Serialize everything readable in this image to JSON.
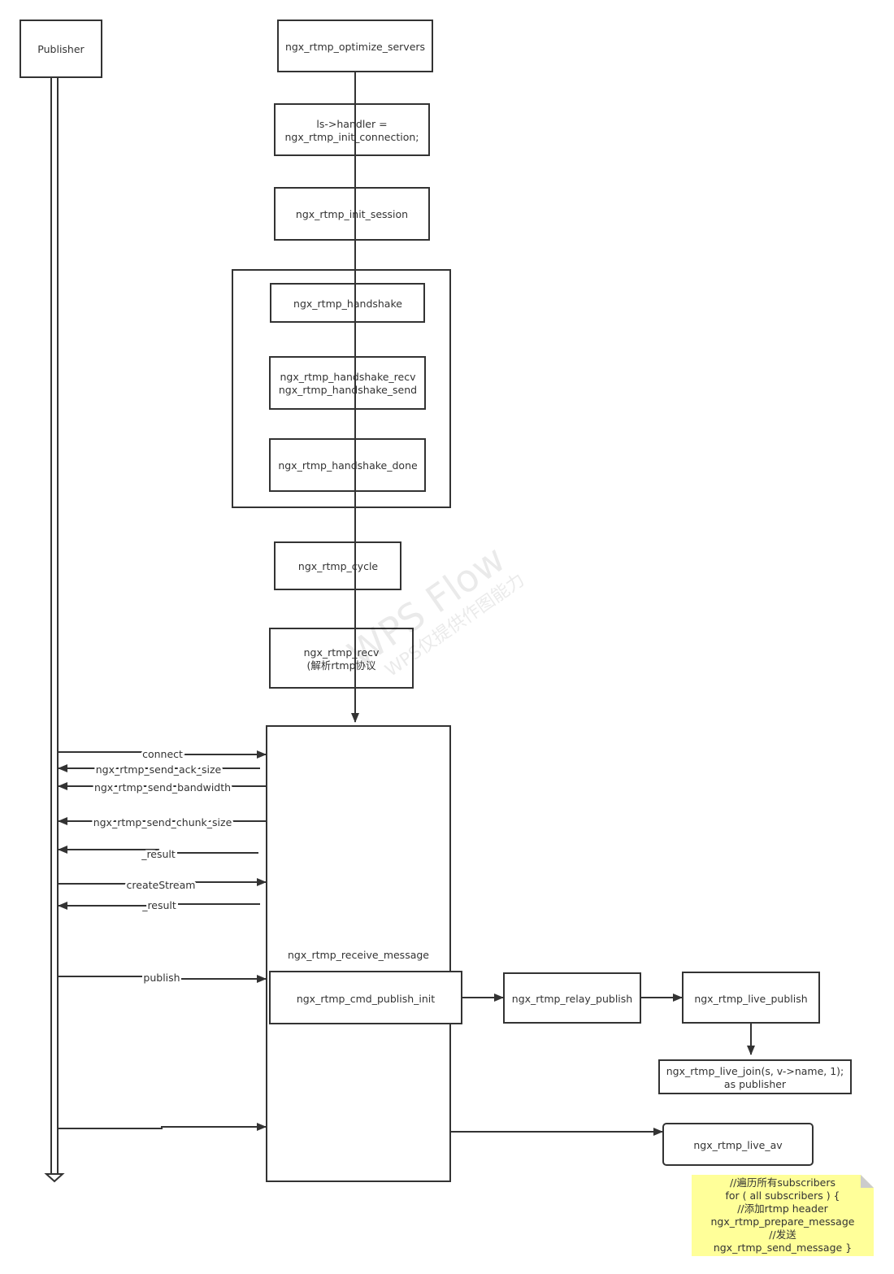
{
  "participant": "Publisher",
  "boxes": {
    "optimize_servers": "ngx_rtmp_optimize_servers",
    "handler_line1": "ls->handler =",
    "handler_line2": "ngx_rtmp_init_connection;",
    "init_session": "ngx_rtmp_init_session",
    "handshake": "ngx_rtmp_handshake",
    "handshake_recv": "ngx_rtmp_handshake_recv",
    "handshake_send": "ngx_rtmp_handshake_send",
    "handshake_done": "ngx_rtmp_handshake_done",
    "cycle": "ngx_rtmp_cycle",
    "recv_line1": "ngx_rtmp_recv",
    "recv_line2": "(解析rtmp协议",
    "receive_message": "ngx_rtmp_receive_message",
    "cmd_publish_init": "ngx_rtmp_cmd_publish_init",
    "relay_publish": "ngx_rtmp_relay_publish",
    "live_publish": "ngx_rtmp_live_publish",
    "live_join_line1": "ngx_rtmp_live_join(s, v->name, 1);",
    "live_join_line2": "as publisher",
    "live_av": "ngx_rtmp_live_av"
  },
  "messages": [
    {
      "label": "connect",
      "direction": "to-server"
    },
    {
      "label": "ngx_rtmp_send_ack_size",
      "direction": "to-publisher"
    },
    {
      "label": "ngx_rtmp_send_bandwidth",
      "direction": "to-publisher"
    },
    {
      "label": "ngx_rtmp_send_chunk_size",
      "direction": "to-publisher"
    },
    {
      "label": "_result",
      "direction": "to-publisher"
    },
    {
      "label": "createStream",
      "direction": "to-server"
    },
    {
      "label": "_result",
      "direction": "to-publisher"
    },
    {
      "label": "publish",
      "direction": "to-server"
    },
    {
      "label": "",
      "direction": "to-server"
    }
  ],
  "note": {
    "lines": [
      "//遍历所有subscribers",
      "for ( all subscribers ) {",
      "//添加rtmp header",
      "ngx_rtmp_prepare_message",
      "//发送",
      "ngx_rtmp_send_message }"
    ],
    "color": "#ffff99"
  },
  "watermark": {
    "title": "WPS Flow",
    "subtitle": "WPS仅提供作图能力"
  }
}
